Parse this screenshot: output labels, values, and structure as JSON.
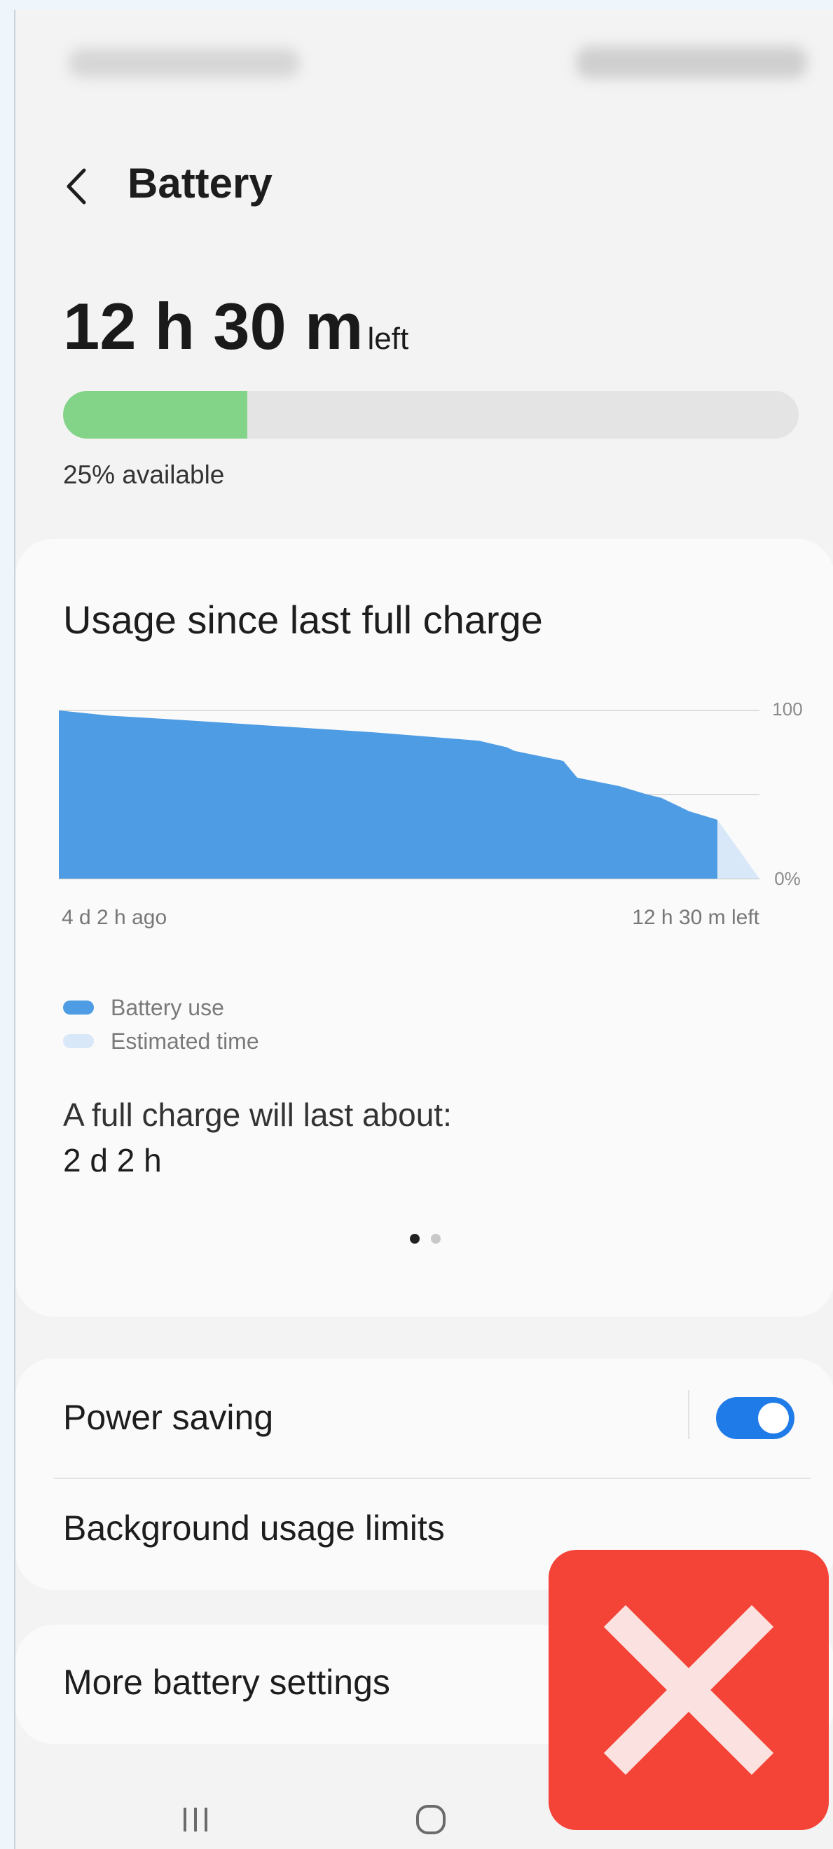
{
  "header": {
    "title": "Battery"
  },
  "battery": {
    "time_left": "12 h 30 m",
    "time_left_suffix": "left",
    "percent": 25,
    "available_text": "25% available"
  },
  "usage": {
    "title": "Usage since last full charge",
    "x_start_label": "4 d 2 h ago",
    "x_end_label": "12 h 30 m left",
    "legend": [
      {
        "label": "Battery use",
        "color": "#4d9ce4"
      },
      {
        "label": "Estimated time",
        "color": "#d9e8f8"
      }
    ],
    "full_charge_label": "A full charge will last about:",
    "full_charge_value": "2 d 2 h",
    "pages": 2,
    "active_page": 0
  },
  "chart_data": {
    "type": "area",
    "y_tick_labels": [
      "100",
      "0%"
    ],
    "ylim": [
      0,
      100
    ],
    "x_labels": [
      "4 d 2 h ago",
      "12 h 30 m left"
    ],
    "series": [
      {
        "name": "Battery use",
        "x": [
          0,
          0.07,
          0.15,
          0.3,
          0.45,
          0.6,
          0.64,
          0.65,
          0.72,
          0.74,
          0.8,
          0.84,
          0.86,
          0.88,
          0.9,
          0.94
        ],
        "y": [
          100,
          97,
          95,
          91,
          87,
          82,
          78,
          76,
          70,
          60,
          55,
          50,
          48,
          44,
          40,
          35
        ]
      },
      {
        "name": "Estimated time",
        "x": [
          0.94,
          1.0
        ],
        "y": [
          35,
          0
        ]
      }
    ]
  },
  "settings": {
    "power_saving_label": "Power saving",
    "power_saving_on": true,
    "background_limits_label": "Background usage limits",
    "more_settings_label": "More battery settings"
  },
  "colors": {
    "accent": "#1f7be8",
    "battery_green": "#83d488",
    "chart_blue": "#4d9ce4",
    "close_red": "#f44337"
  },
  "icons": {
    "back": "chevron-left-icon",
    "recents": "recents-icon",
    "home": "home-icon",
    "close": "close-icon"
  }
}
